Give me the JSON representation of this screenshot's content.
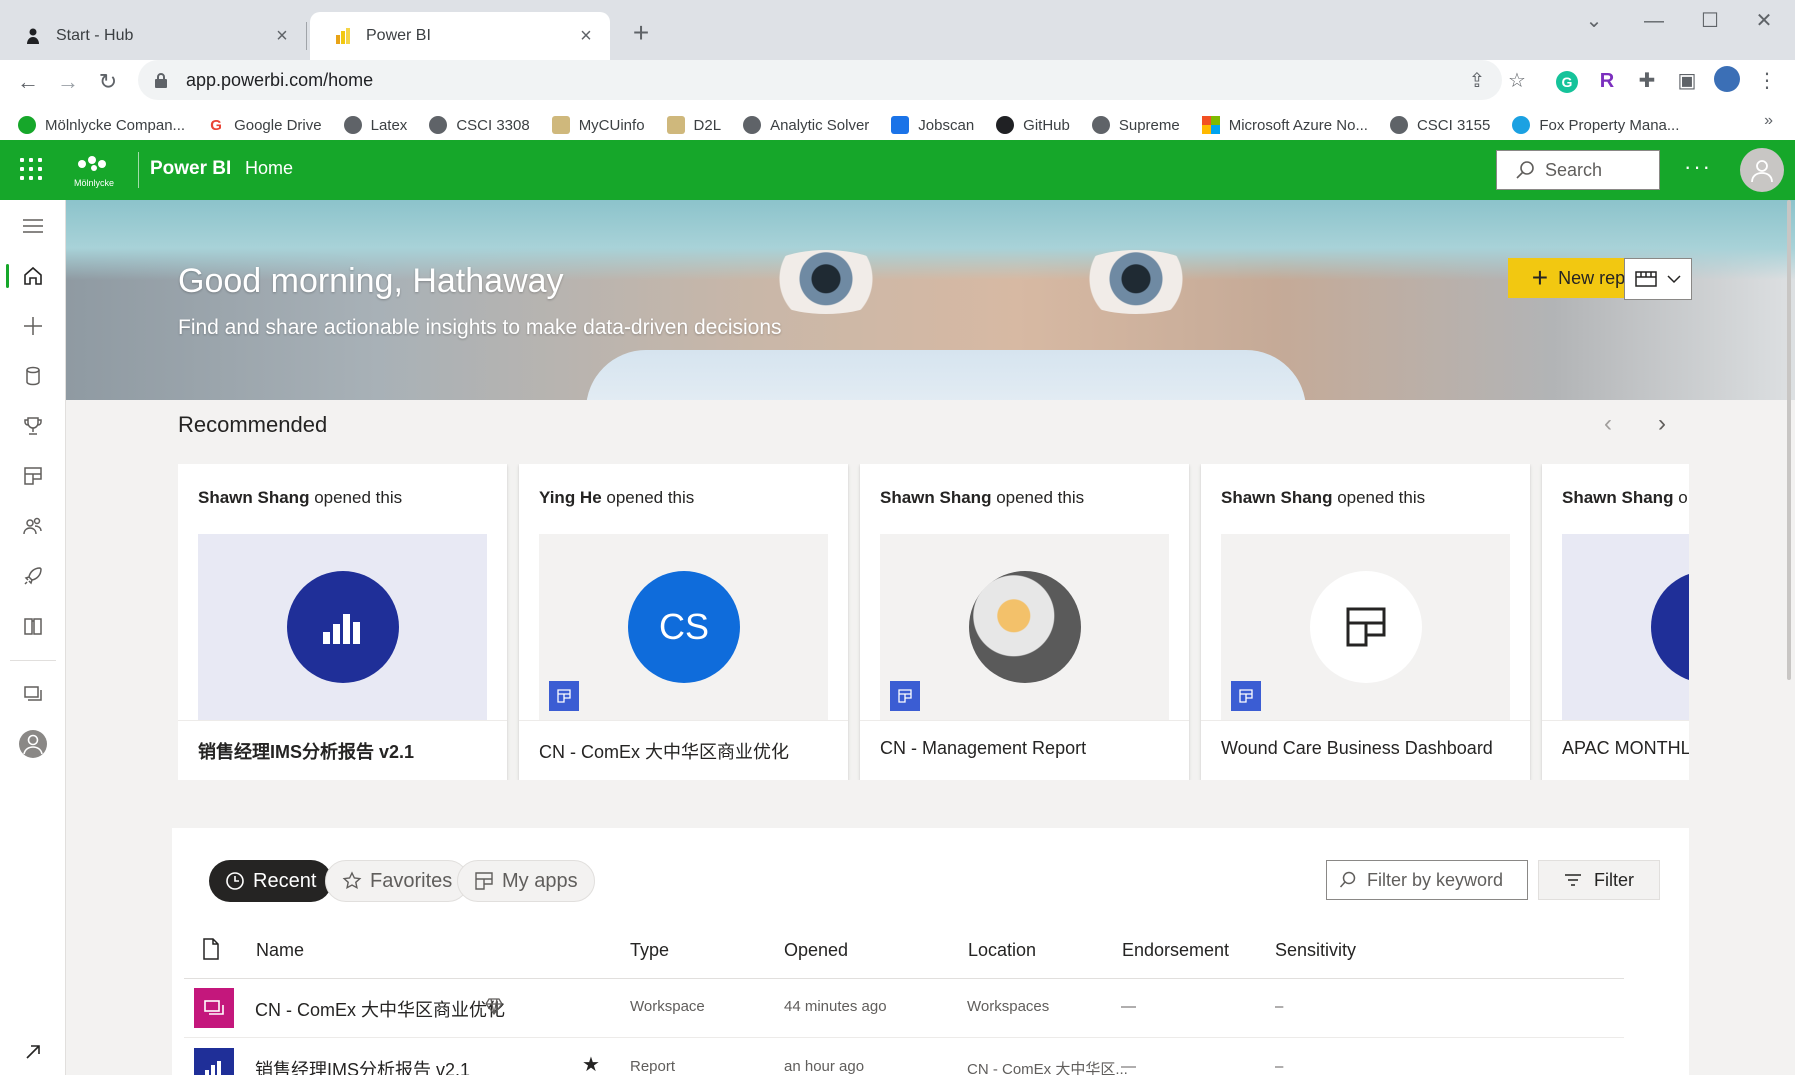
{
  "browser": {
    "tabs": [
      {
        "title": "Start - Hub",
        "icon": "person-icon",
        "active": false
      },
      {
        "title": "Power BI",
        "icon": "powerbi-icon",
        "active": true
      }
    ],
    "new_tab": "+",
    "url": "app.powerbi.com/home",
    "bookmarks": [
      {
        "label": "Mölnlycke Compan...",
        "icon": "molnlycke-icon"
      },
      {
        "label": "Google Drive",
        "icon": "google-icon"
      },
      {
        "label": "Latex",
        "icon": "globe-icon"
      },
      {
        "label": "CSCI 3308",
        "icon": "globe-icon"
      },
      {
        "label": "MyCUinfo",
        "icon": "cu-icon"
      },
      {
        "label": "D2L",
        "icon": "cu-icon"
      },
      {
        "label": "Analytic Solver",
        "icon": "globe-icon"
      },
      {
        "label": "Jobscan",
        "icon": "jobscan-icon"
      },
      {
        "label": "GitHub",
        "icon": "github-icon"
      },
      {
        "label": "Supreme",
        "icon": "globe-icon"
      },
      {
        "label": "Microsoft Azure No...",
        "icon": "microsoft-icon"
      },
      {
        "label": "CSCI 3155",
        "icon": "globe-icon"
      },
      {
        "label": "Fox Property Mana...",
        "icon": "fox-icon"
      }
    ],
    "bookmarks_more": "»"
  },
  "header": {
    "brand_text": "Mölnlycke",
    "app_name": "Power BI",
    "page": "Home",
    "search_placeholder": "Search",
    "more": "···"
  },
  "hero": {
    "greeting": "Good morning, Hathaway",
    "subtitle": "Find and share actionable insights to make data-driven decisions",
    "new_report_label": "New report"
  },
  "recommended": {
    "title": "Recommended",
    "cards": [
      {
        "person": "Shawn Shang",
        "action": " opened this",
        "name": "销售经理IMS分析报告 v2.1",
        "thumb": "report"
      },
      {
        "person": "Ying He",
        "action": " opened this",
        "name": "CN - ComEx 大中华区商业优化",
        "thumb": "initials",
        "initials": "CS"
      },
      {
        "person": "Shawn Shang",
        "action": " opened this",
        "name": "CN - Management Report",
        "thumb": "image"
      },
      {
        "person": "Shawn Shang",
        "action": " opened this",
        "name": "Wound Care Business Dashboard",
        "thumb": "app"
      },
      {
        "person": "Shawn Shang",
        "action": " o",
        "name": "APAC MONTHLY",
        "thumb": "report"
      }
    ]
  },
  "recent": {
    "tabs": {
      "recent": "Recent",
      "favorites": "Favorites",
      "my_apps": "My apps"
    },
    "filter_placeholder": "Filter by keyword",
    "filter_label": "Filter",
    "columns": {
      "name": "Name",
      "type": "Type",
      "opened": "Opened",
      "location": "Location",
      "endorsement": "Endorsement",
      "sensitivity": "Sensitivity"
    },
    "rows": [
      {
        "name": "CN - ComEx 大中华区商业优化",
        "type": "Workspace",
        "opened": "44 minutes ago",
        "location": "Workspaces",
        "endorsement": "—",
        "sensitivity": "–",
        "icon": "workspace-icon"
      },
      {
        "name": "销售经理IMS分析报告 v2.1",
        "type": "Report",
        "opened": "an hour ago",
        "location": "CN - ComEx 大中华区...",
        "endorsement": "—",
        "sensitivity": "–",
        "icon": "report-icon"
      }
    ]
  },
  "colors": {
    "header_green": "#16a72a",
    "new_report_yellow": "#f2c811",
    "report_blue": "#1f2f98",
    "initials_blue": "#0f6cdb",
    "workspace_magenta": "#c4177c"
  }
}
